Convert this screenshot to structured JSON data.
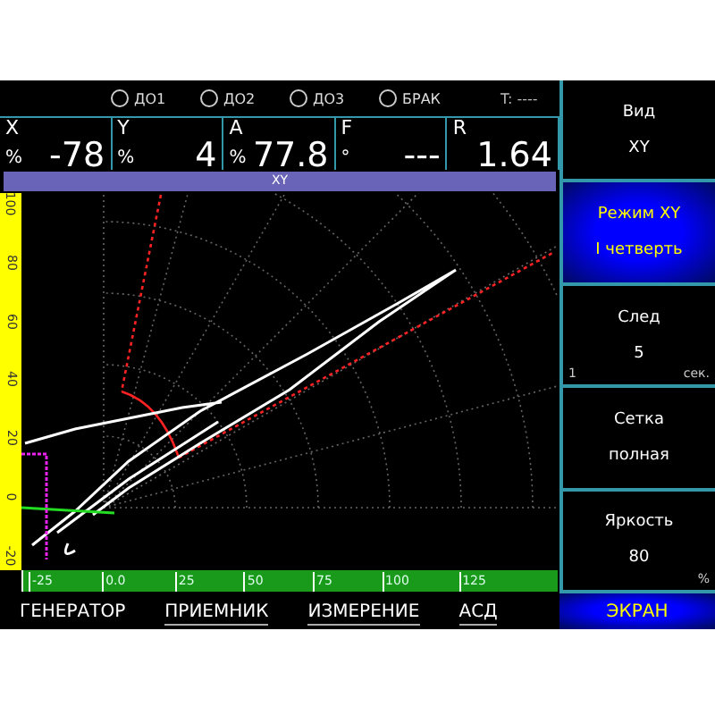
{
  "indicators": [
    {
      "label": "ДО1",
      "on": false
    },
    {
      "label": "ДО2",
      "on": false
    },
    {
      "label": "ДО3",
      "on": false
    },
    {
      "label": "БРАК",
      "on": false
    }
  ],
  "timer": "T: ----",
  "readings": [
    {
      "name": "X",
      "unit": "%",
      "value": "-78"
    },
    {
      "name": "Y",
      "unit": "%",
      "value": "4"
    },
    {
      "name": "A",
      "unit": "%",
      "value": "77.8"
    },
    {
      "name": "F",
      "unit": "°",
      "value": "---"
    },
    {
      "name": "R",
      "value": "1.64"
    }
  ],
  "plot": {
    "title": "XY",
    "y_axis_labels": [
      "100",
      "80",
      "60",
      "40",
      "20",
      "0",
      "-20"
    ],
    "x_axis_labels": [
      "-25",
      "0.0",
      "25",
      "50",
      "75",
      "100",
      "125"
    ]
  },
  "side_menu": [
    {
      "title": "Вид",
      "value": "XY",
      "selected": false
    },
    {
      "title": "Режим XY",
      "value": "I четверть",
      "selected": true
    },
    {
      "title": "След",
      "value": "5",
      "min": "1",
      "unit": "сек.",
      "selected": false
    },
    {
      "title": "Сетка",
      "value": "полная",
      "selected": false
    },
    {
      "title": "Яркость",
      "value": "80",
      "unit": "%",
      "selected": false
    }
  ],
  "tabs": [
    {
      "label": "ГЕНЕРАТОР",
      "underlined": false,
      "selected": false
    },
    {
      "label": "ПРИЕМНИК",
      "underlined": true,
      "selected": false
    },
    {
      "label": "ИЗМЕРЕНИЕ",
      "underlined": true,
      "selected": false
    },
    {
      "label": "АСД",
      "underlined": true,
      "selected": false
    },
    {
      "label": "ЭКРАН",
      "underlined": false,
      "selected": true
    }
  ]
}
